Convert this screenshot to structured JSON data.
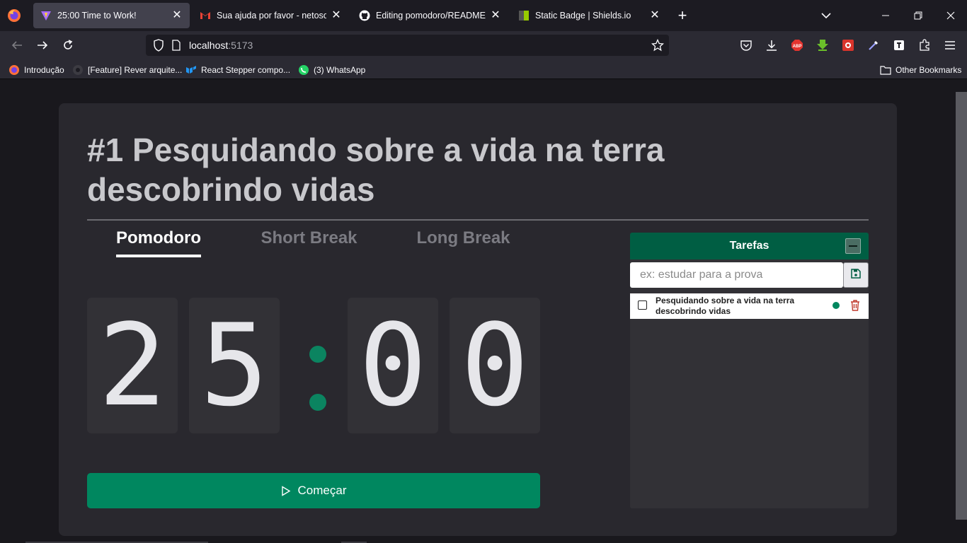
{
  "browser": {
    "tabs": [
      {
        "title": "25:00 Time to Work!",
        "icon": "vite-icon",
        "active": true
      },
      {
        "title": "Sua ajuda por favor - netosouza",
        "icon": "gmail-icon",
        "active": false
      },
      {
        "title": "Editing pomodoro/README.md",
        "icon": "github-icon",
        "active": false
      },
      {
        "title": "Static Badge | Shields.io",
        "icon": "shields-icon",
        "active": false
      }
    ],
    "url_host": "localhost",
    "url_port": ":5173",
    "bookmarks": [
      {
        "label": "Introdução",
        "icon": "firefox-icon"
      },
      {
        "label": "[Feature] Rever arquite...",
        "icon": "github-icon"
      },
      {
        "label": "React Stepper compo...",
        "icon": "mui-icon"
      },
      {
        "label": "(3) WhatsApp",
        "icon": "whatsapp-icon"
      }
    ],
    "other_bookmarks": "Other Bookmarks",
    "extensions": [
      "pocket-icon",
      "download-icon",
      "adblock-icon",
      "download-helper-icon",
      "screenshot-icon",
      "color-picker-icon",
      "toggl-icon",
      "extensions-icon",
      "menu-icon"
    ]
  },
  "app": {
    "heading": "#1 Pesquidando sobre a vida na terra descobrindo vidas",
    "modes": [
      "Pomodoro",
      "Short Break",
      "Long Break"
    ],
    "active_mode": "Pomodoro",
    "timer": {
      "m1": "2",
      "m2": "5",
      "s1": "0",
      "s2": "0"
    },
    "start_label": "Começar",
    "tasks": {
      "title": "Tarefas",
      "input_placeholder": "ex: estudar para a prova",
      "input_value": "",
      "items": [
        {
          "text": "Pesquidando sobre a vida na terra descobrindo vidas",
          "done": false,
          "active": true
        }
      ]
    },
    "colors": {
      "accent": "#00875f",
      "header": "#005e43",
      "card": "#29282e",
      "delete": "#c0392b"
    }
  }
}
